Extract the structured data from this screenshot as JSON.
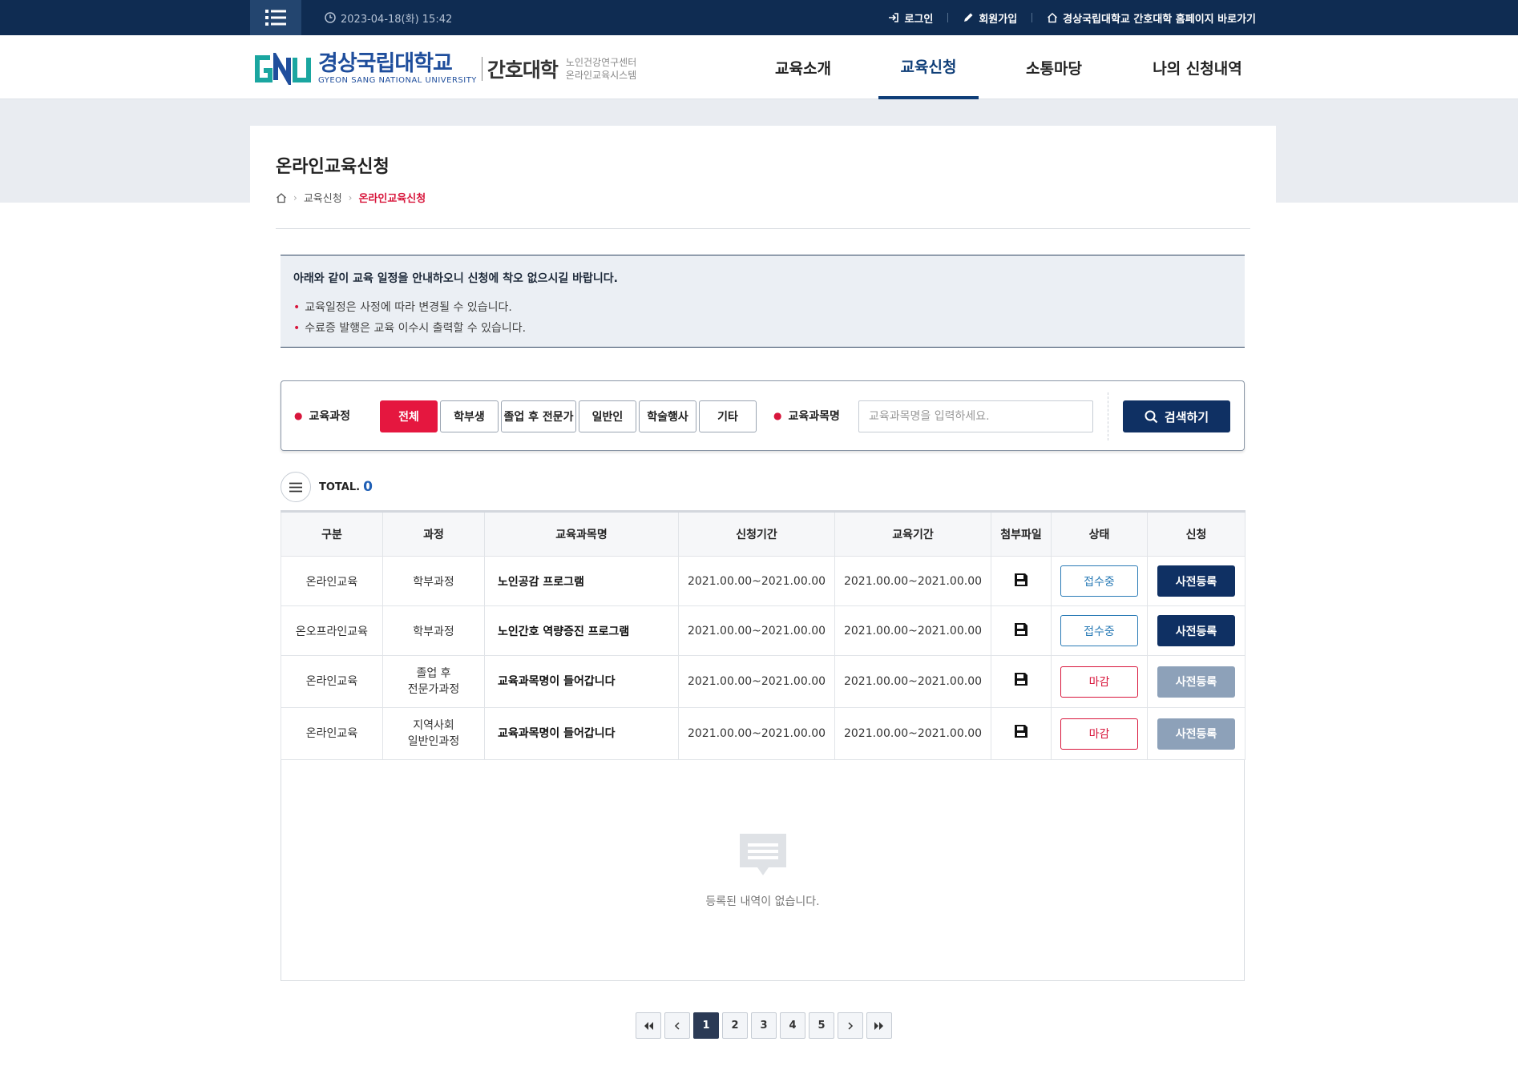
{
  "topbar": {
    "datetime": "2023-04-18(화) 15:42",
    "login": "로그인",
    "signup": "회원가입",
    "homepage": "경상국립대학교 간호대학 홈페이지 바로가기"
  },
  "header": {
    "logo_ko": "경상국립대학교",
    "logo_en": "GYEON SANG NATIONAL UNIVERSITY",
    "college": "간호대학",
    "sub1": "노인건강연구센터",
    "sub2": "온라인교육시스템",
    "nav": [
      "교육소개",
      "교육신청",
      "소통마당",
      "나의 신청내역"
    ],
    "active_nav": "교육신청"
  },
  "page": {
    "title": "온라인교육신청",
    "breadcrumb": [
      "교육신청",
      "온라인교육신청"
    ]
  },
  "notice": {
    "heading": "아래와 같이 교육 일정을 안내하오니 신청에 착오 없으시길 바랍니다.",
    "items": [
      "교육일정은 사정에 따라 변경될 수 있습니다.",
      "수료증 발행은 교육 이수시 출력할 수 있습니다."
    ]
  },
  "search": {
    "course_label": "교육과정",
    "filters": [
      "전체",
      "학부생",
      "졸업 후 전문가",
      "일반인",
      "학술행사",
      "기타"
    ],
    "active_filter": "전체",
    "subject_label": "교육과목명",
    "placeholder": "교육과목명을 입력하세요.",
    "button": "검색하기"
  },
  "total": {
    "label": "TOTAL.",
    "count": "0"
  },
  "table": {
    "headers": [
      "구분",
      "과정",
      "교육과목명",
      "신청기간",
      "교육기간",
      "첨부파일",
      "상태",
      "신청"
    ],
    "rows": [
      {
        "type": "온라인교육",
        "course": "학부과정",
        "subject": "노인공감 프로그램",
        "apply_period": "2021.00.00~2021.00.00",
        "edu_period": "2021.00.00~2021.00.00",
        "status": "접수중",
        "apply": "사전등록"
      },
      {
        "type": "온오프라인교육",
        "course": "학부과정",
        "subject": "노인간호 역량증진 프로그램",
        "apply_period": "2021.00.00~2021.00.00",
        "edu_period": "2021.00.00~2021.00.00",
        "status": "접수중",
        "apply": "사전등록"
      },
      {
        "type": "온라인교육",
        "course": "졸업 후\n전문가과정",
        "subject": "교육과목명이 들어갑니다",
        "apply_period": "2021.00.00~2021.00.00",
        "edu_period": "2021.00.00~2021.00.00",
        "status": "마감",
        "apply": "사전등록"
      },
      {
        "type": "온라인교육",
        "course": "지역사회\n일반인과정",
        "subject": "교육과목명이 들어갑니다",
        "apply_period": "2021.00.00~2021.00.00",
        "edu_period": "2021.00.00~2021.00.00",
        "status": "마감",
        "apply": "사전등록"
      }
    ]
  },
  "empty": {
    "message": "등록된 내역이 없습니다."
  },
  "pagination": {
    "pages": [
      "1",
      "2",
      "3",
      "4",
      "5"
    ],
    "current": "1"
  },
  "colors": {
    "navy": "#0f2c52",
    "accent_red": "#e5173f",
    "button_navy": "#0f3063",
    "disabled": "#8da1b9",
    "status_open": "#2a7bb6"
  }
}
